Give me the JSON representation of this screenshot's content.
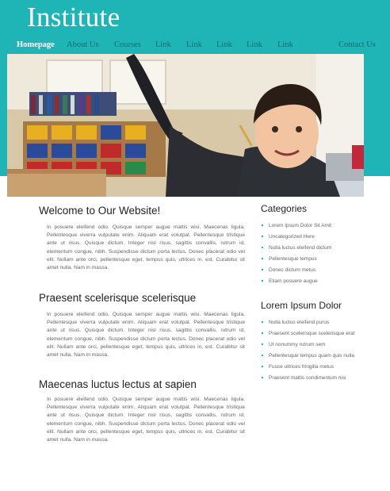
{
  "site": {
    "title": "Institute"
  },
  "nav": [
    "Homepage",
    "About Us",
    "Courses",
    "Link",
    "Link",
    "Link",
    "Link",
    "Link",
    "Contact Us"
  ],
  "articles": [
    {
      "title": "Welcome to Our Website!",
      "body": "In posuere eleifend odio. Quisque semper augue mattis wisi. Maecenas ligula. Pellentesque viverra vulputate enim. Aliquam erat volutpat. Pellentesque tristique ante ut risus. Quisque dictum. Integer nisl risus, sagittis convallis, rutrum id, elementum congue, nibh. Suspendisse dictum porta lectus. Donec placerat odio vel elit. Nullam ante orci, pellentesque eget, tempus quis, ultrices in, est. Curabitur sit amet nulla. Nam in massa."
    },
    {
      "title": "Praesent scelerisque scelerisque",
      "body": "In posuere eleifend odio. Quisque semper augue mattis wisi. Maecenas ligula. Pellentesque viverra vulputate enim. Aliquam erat volutpat. Pellentesque tristique ante ut risus. Quisque dictum. Integer nisl risus, sagittis convallis, rutrum id, elementum congue, nibh. Suspendisse dictum porta lectus. Donec placerat odio vel elit. Nullam ante orci, pellentesque eget, tempus quis, ultrices in, est. Curabitur sit amet nulla. Nam in massa."
    },
    {
      "title": "Maecenas luctus lectus at sapien",
      "body": "In posuere eleifend odio. Quisque semper augue mattis wisi. Maecenas ligula. Pellentesque viverra vulputate enim. Aliquam erat volutpat. Pellentesque tristique ante ut risus. Quisque dictum. Integer nisl risus, sagittis convallis, rutrum id, elementum congue, nibh. Suspendisse dictum porta lectus. Donec placerat odio vel elit. Nullam ante orci, pellentesque eget, tempus quis, ultrices in, est. Curabitur sit amet nulla. Nam in massa."
    }
  ],
  "sidebar": {
    "categories": {
      "title": "Categories",
      "items": [
        "Lorem Ipsum Dolor Sit Amit",
        "Uncategorized Here",
        "Nulla luctus eleifend dictum",
        "Pellentesque tempus",
        "Donec dictum metus",
        "Etiam posuere augue"
      ]
    },
    "lorem": {
      "title": "Lorem Ipsum Dolor",
      "items": [
        "Nulla luctus eleifend purus",
        "Praesent scelerisque scelerisque erat",
        "Ut nonummy rutrum sem",
        "Pellentesque tempus quam quis nulla",
        "Fusce ultrices fringilla metus",
        "Praesent mattis condimentum nisi"
      ]
    }
  },
  "colors": {
    "accent": "#1fb5b7",
    "nav_text": "#0f6e70",
    "bullet": "#1fb5b7"
  }
}
